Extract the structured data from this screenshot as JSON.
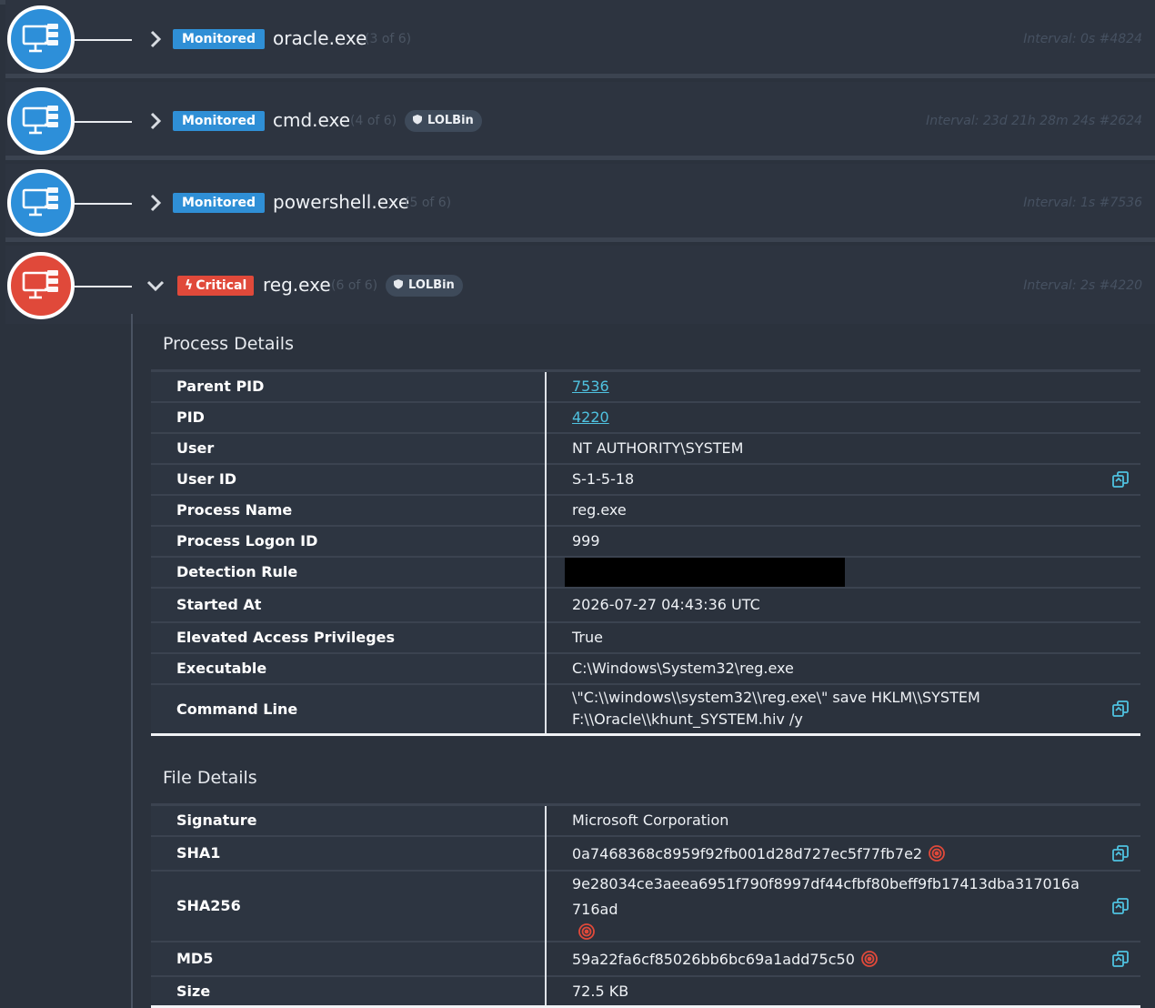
{
  "processes": [
    {
      "status": "Monitored",
      "name": "oracle.exe",
      "count": "(3 of 6)",
      "lolbin": "",
      "interval": "Interval: 0s #4824",
      "severity": "blue"
    },
    {
      "status": "Monitored",
      "name": "cmd.exe",
      "count": "(4 of 6)",
      "lolbin": "LOLBin",
      "interval": "Interval: 23d 21h 28m 24s #2624",
      "severity": "blue"
    },
    {
      "status": "Monitored",
      "name": "powershell.exe",
      "count": "(5 of 6)",
      "lolbin": "",
      "interval": "Interval: 1s #7536",
      "severity": "blue"
    },
    {
      "status": "Critical",
      "name": "reg.exe",
      "count": "(6 of 6)",
      "lolbin": "LOLBin",
      "interval": "Interval: 2s #4220",
      "severity": "red"
    }
  ],
  "process_details": {
    "title": "Process Details",
    "rows": [
      {
        "label": "Parent PID",
        "value": "7536",
        "link": true
      },
      {
        "label": "PID",
        "value": "4220",
        "link": true
      },
      {
        "label": "User",
        "value": "NT AUTHORITY\\SYSTEM"
      },
      {
        "label": "User ID",
        "value": "S-1-5-18",
        "copy": true
      },
      {
        "label": "Process Name",
        "value": "reg.exe"
      },
      {
        "label": "Process Logon ID",
        "value": "999"
      },
      {
        "label": "Detection Rule",
        "value": "",
        "redacted": true
      },
      {
        "label": "Started At",
        "value": "2026-07-27 04:43:36 UTC"
      },
      {
        "label": "Elevated Access Privileges",
        "value": "True"
      },
      {
        "label": "Executable",
        "value": "C:\\Windows\\System32\\reg.exe"
      },
      {
        "label": "Command Line",
        "value": "\\\"C:\\\\windows\\\\system32\\\\reg.exe\\\" save HKLM\\\\SYSTEM F:\\\\Oracle\\\\khunt_SYSTEM.hiv /y",
        "copy": true
      }
    ]
  },
  "file_details": {
    "title": "File Details",
    "rows": [
      {
        "label": "Signature",
        "value": "Microsoft Corporation"
      },
      {
        "label": "SHA1",
        "value": "0a7468368c8959f92fb001d28d727ec5f77fb7e2",
        "copy": true,
        "target": true
      },
      {
        "label": "SHA256",
        "value": "9e28034ce3aeea6951f790f8997df44cfbf80beff9fb17413dba317016a716ad",
        "copy": true,
        "target": true
      },
      {
        "label": "MD5",
        "value": "59a22fa6cf85026bb6bc69a1add75c50",
        "copy": true,
        "target": true
      },
      {
        "label": "Size",
        "value": "72.5 KB"
      }
    ]
  },
  "icons": {
    "node": "monitor-tree-icon",
    "expand": "chevron-right-icon",
    "collapse": "chevron-down-icon",
    "copy": "copy-icon",
    "target": "target-icon",
    "lolbin": "shield-icon",
    "critical": "bolt-icon"
  },
  "colors": {
    "monitored": "#2f8fd6",
    "critical": "#e0493a",
    "link": "#4fc2e0",
    "background": "#2b323d"
  }
}
